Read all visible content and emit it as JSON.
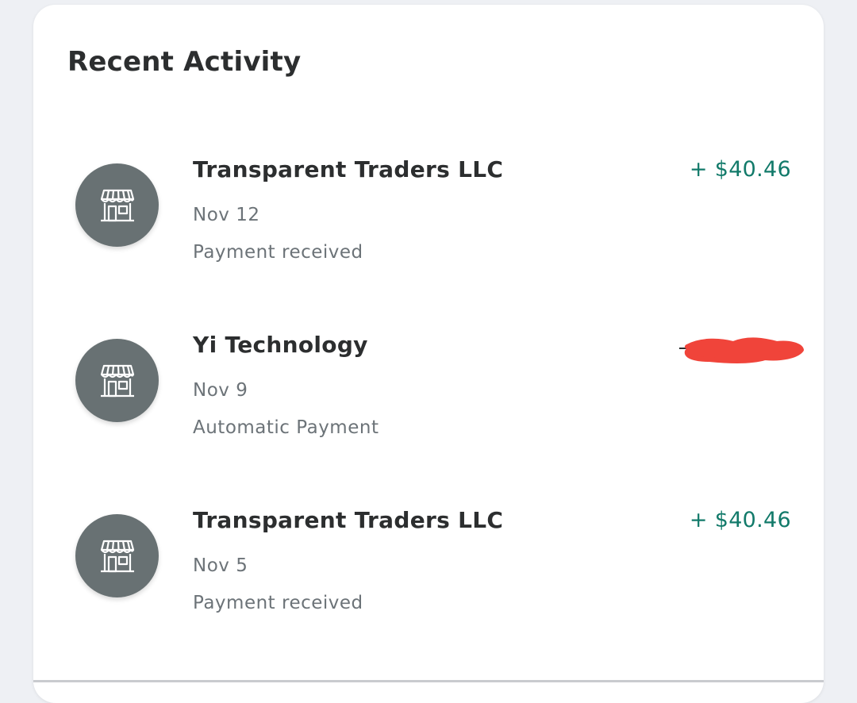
{
  "recent_activity": {
    "title": "Recent Activity",
    "items": [
      {
        "name": "Transparent Traders LLC",
        "date": "Nov 12",
        "description": "Payment received",
        "amount": "+ $40.46",
        "icon": "storefront-icon"
      },
      {
        "name": "Yi Technology",
        "date": "Nov 9",
        "description": "Automatic Payment",
        "amount_redacted": true,
        "icon": "storefront-icon"
      },
      {
        "name": "Transparent Traders LLC",
        "date": "Nov 5",
        "description": "Payment received",
        "amount": "+ $40.46",
        "icon": "storefront-icon"
      }
    ]
  },
  "colors": {
    "page_background": "#eef0f4",
    "card_background": "#ffffff",
    "avatar_background": "#687173",
    "amount_positive": "#127a6a",
    "primary_text": "#2c2e2f",
    "secondary_text": "#6c7378",
    "redaction_marker": "#f0443a"
  }
}
